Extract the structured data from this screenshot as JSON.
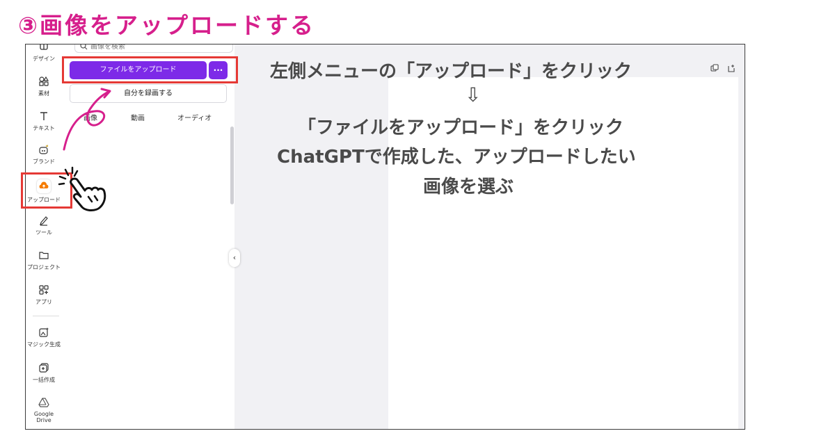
{
  "headline": "③画像をアップロードする",
  "rail": {
    "items": [
      {
        "label": "デザイン",
        "icon": "design-icon"
      },
      {
        "label": "素材",
        "icon": "elements-icon"
      },
      {
        "label": "テキスト",
        "icon": "text-icon"
      },
      {
        "label": "ブランド",
        "icon": "brand-icon"
      },
      {
        "label": "アップロード",
        "icon": "upload-cloud-icon"
      },
      {
        "label": "ツール",
        "icon": "pen-tool-icon"
      },
      {
        "label": "プロジェクト",
        "icon": "folder-icon"
      },
      {
        "label": "アプリ",
        "icon": "apps-icon"
      },
      {
        "label": "マジック生成",
        "icon": "magic-image-icon"
      },
      {
        "label": "一括作成",
        "icon": "bulk-create-icon"
      },
      {
        "label": "Google Drive",
        "icon": "google-drive-icon"
      }
    ]
  },
  "panel": {
    "search_placeholder": "画像を検索",
    "upload_button": "ファイルをアップロード",
    "more_button": "···",
    "record_button": "自分を録画する",
    "tabs": [
      "画像",
      "動画",
      "オーディオ"
    ],
    "collapse_glyph": "‹"
  },
  "instructions": {
    "line1": "左側メニューの「アップロード」をクリック",
    "arrow": "⇩",
    "line2": "「ファイルをアップロード」をクリック",
    "line3": "ChatGPTで作成した、アップロードしたい",
    "line4": "画像を選ぶ"
  },
  "colors": {
    "headline": "#d61f8c",
    "accent": "#7d2ae8",
    "highlight_box": "#e53935",
    "annotation_arrow": "#d61f8c",
    "upload_icon": "#f57c00"
  }
}
